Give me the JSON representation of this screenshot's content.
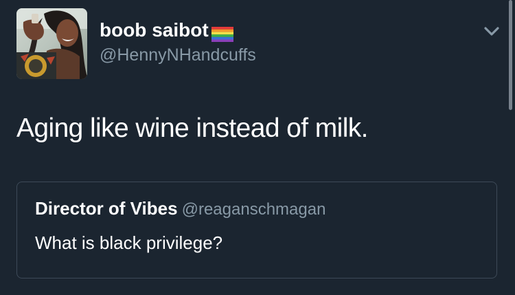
{
  "tweet": {
    "author": {
      "display_name": "boob saibot",
      "handle": "@HennyNHandcuffs",
      "avatar_icon": "profile-photo",
      "name_badge_icon": "rainbow-flag-icon"
    },
    "text": "Aging like wine instead of milk.",
    "menu_icon": "chevron-down-icon",
    "quoted_tweet": {
      "display_name": "Director of Vibes",
      "handle": "@reaganschmagan",
      "text": "What is black privilege?"
    }
  },
  "colors": {
    "background": "#1b2530",
    "primary_text": "#ffffff",
    "secondary_text": "#8899a6",
    "quote_border": "#3d4a58"
  }
}
